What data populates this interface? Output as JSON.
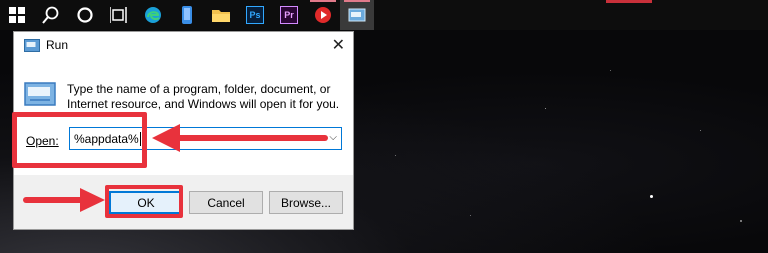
{
  "taskbar": {
    "items": [
      {
        "name": "start",
        "icon": "windows-logo-icon"
      },
      {
        "name": "search",
        "icon": "search-icon"
      },
      {
        "name": "cortana",
        "icon": "cortana-circle-icon"
      },
      {
        "name": "task-view",
        "icon": "task-view-icon"
      },
      {
        "name": "edge",
        "icon": "edge-icon"
      },
      {
        "name": "phone",
        "icon": "phone-app-icon"
      },
      {
        "name": "explorer",
        "icon": "folder-icon"
      },
      {
        "name": "photoshop",
        "icon": "photoshop-icon",
        "text": "Ps"
      },
      {
        "name": "premiere",
        "icon": "premiere-icon",
        "text": "Pr"
      },
      {
        "name": "media-player",
        "icon": "media-player-icon"
      },
      {
        "name": "run",
        "icon": "run-icon"
      }
    ]
  },
  "dialog": {
    "title": "Run",
    "close": "✕",
    "description": "Type the name of a program, folder, document, or Internet resource, and Windows will open it for you.",
    "open_label": "Open:",
    "open_value": "%appdata%",
    "ok_label": "OK",
    "cancel_label": "Cancel",
    "browse_label": "Browse..."
  },
  "annotations": {
    "color": "#e8323c"
  }
}
